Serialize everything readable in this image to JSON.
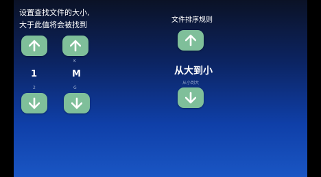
{
  "size_panel": {
    "description_line1": "设置查找文件的大小,",
    "description_line2": "大于此值将会被找到",
    "number": {
      "value": "1",
      "hint": "2"
    },
    "unit": {
      "value": "M",
      "hint_above": "K",
      "hint_below": "G"
    }
  },
  "sort_panel": {
    "title": "文件排序规则",
    "value": "从大到小",
    "hint": "从小到大"
  },
  "icons": {
    "up": "arrow-up-icon",
    "down": "arrow-down-icon"
  },
  "colors": {
    "button": "#7fbf9a",
    "arrow": "#ffffff"
  }
}
